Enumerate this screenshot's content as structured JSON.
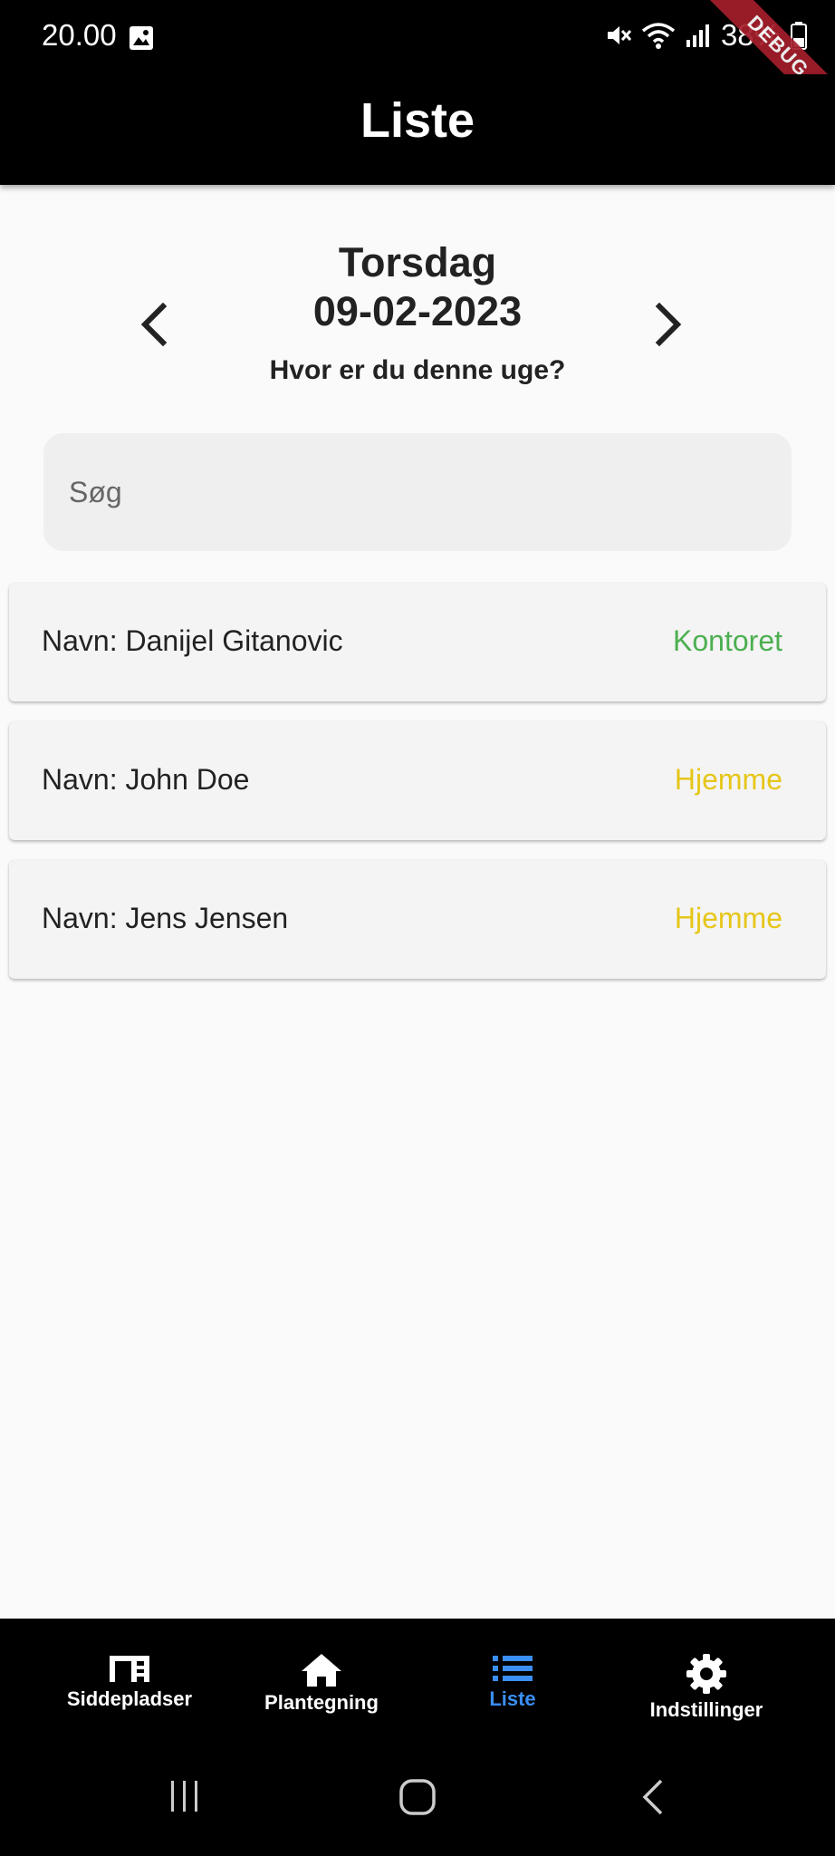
{
  "status_bar": {
    "time": "20.00",
    "battery": "38%",
    "icons": [
      "image-icon",
      "mute-icon",
      "wifi-icon",
      "signal-icon",
      "battery-icon"
    ]
  },
  "debug_banner": "DEBUG",
  "app_bar": {
    "title": "Liste"
  },
  "date_nav": {
    "day": "Torsdag",
    "date": "09-02-2023",
    "question": "Hvor er du denne uge?",
    "prev_icon": "chevron-left-icon",
    "next_icon": "chevron-right-icon"
  },
  "search": {
    "placeholder": "Søg",
    "value": ""
  },
  "people": [
    {
      "name": "Navn: Danijel Gitanovic",
      "status": "Kontoret",
      "status_color": "#4caf50"
    },
    {
      "name": "Navn: John Doe",
      "status": "Hjemme",
      "status_color": "#e6c619"
    },
    {
      "name": "Navn: Jens Jensen",
      "status": "Hjemme",
      "status_color": "#e6c619"
    }
  ],
  "bottom_nav": {
    "items": [
      {
        "label": "Siddepladser",
        "icon": "desk-icon",
        "active": false
      },
      {
        "label": "Plantegning",
        "icon": "home-icon",
        "active": false
      },
      {
        "label": "Liste",
        "icon": "list-icon",
        "active": true
      },
      {
        "label": "Indstillinger",
        "icon": "gear-icon",
        "active": false
      }
    ],
    "active_color": "#3b8ef3"
  },
  "system_nav": {
    "icons": [
      "recents-icon",
      "home-circle-icon",
      "back-icon"
    ]
  }
}
